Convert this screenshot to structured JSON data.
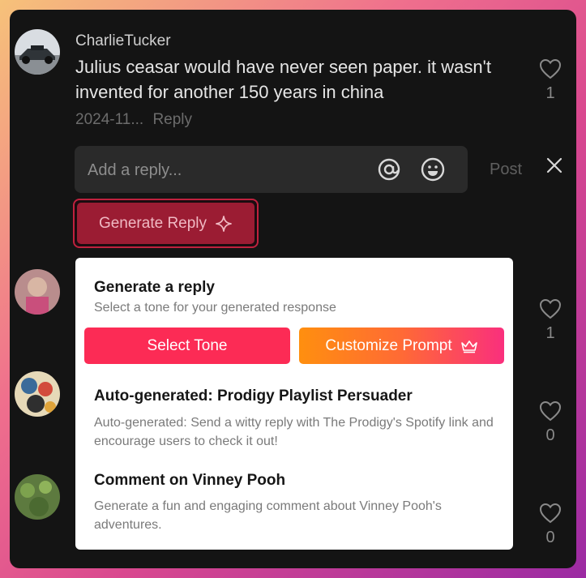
{
  "comment": {
    "username": "CharlieTucker",
    "text": "Julius ceasar would have never seen paper. it wasn't invented for another 150 years in china",
    "date": "2024-11...",
    "reply_label": "Reply",
    "likes": "1"
  },
  "reply_box": {
    "placeholder": "Add a reply...",
    "post_label": "Post"
  },
  "generate_button": {
    "label": "Generate Reply"
  },
  "popup": {
    "title": "Generate a reply",
    "subtitle": "Select a tone for your generated response",
    "select_tone_label": "Select Tone",
    "customize_prompt_label": "Customize Prompt",
    "items": [
      {
        "title": "Auto-generated: Prodigy Playlist Persuader",
        "description": "Auto-generated: Send a witty reply with The Prodigy's Spotify link and encourage users to check it out!"
      },
      {
        "title": "Comment on Vinney Pooh",
        "description": "Generate a fun and engaging comment about Vinney Pooh's adventures."
      }
    ]
  },
  "side_likes": [
    "1",
    "0",
    "0"
  ],
  "colors": {
    "accent": "#fc2b55",
    "generate_bg": "#9b1c33",
    "panel_bg": "#141414"
  }
}
